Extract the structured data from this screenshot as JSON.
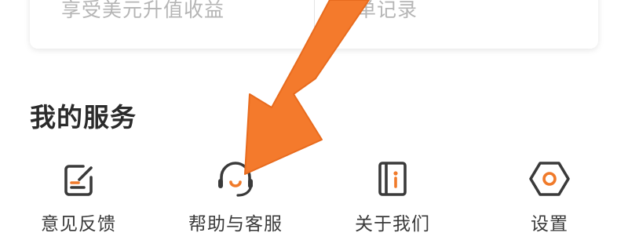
{
  "top_card": {
    "left_text": "享受美元升值收益",
    "right_text": "订单记录"
  },
  "section": {
    "title": "我的服务"
  },
  "services": [
    {
      "label": "意见反馈",
      "icon": "feedback-edit-icon"
    },
    {
      "label": "帮助与客服",
      "icon": "headset-icon"
    },
    {
      "label": "关于我们",
      "icon": "info-book-icon"
    },
    {
      "label": "设置",
      "icon": "gear-hexagon-icon"
    }
  ],
  "colors": {
    "icon_dark": "#3a3a3a",
    "accent": "#f07a2a",
    "arrow": "#f47a2c",
    "title": "#2b2b2b",
    "muted_text": "#b5b5b5"
  },
  "annotation": {
    "icon": "pointer-arrow-icon",
    "target": "帮助与客服"
  }
}
